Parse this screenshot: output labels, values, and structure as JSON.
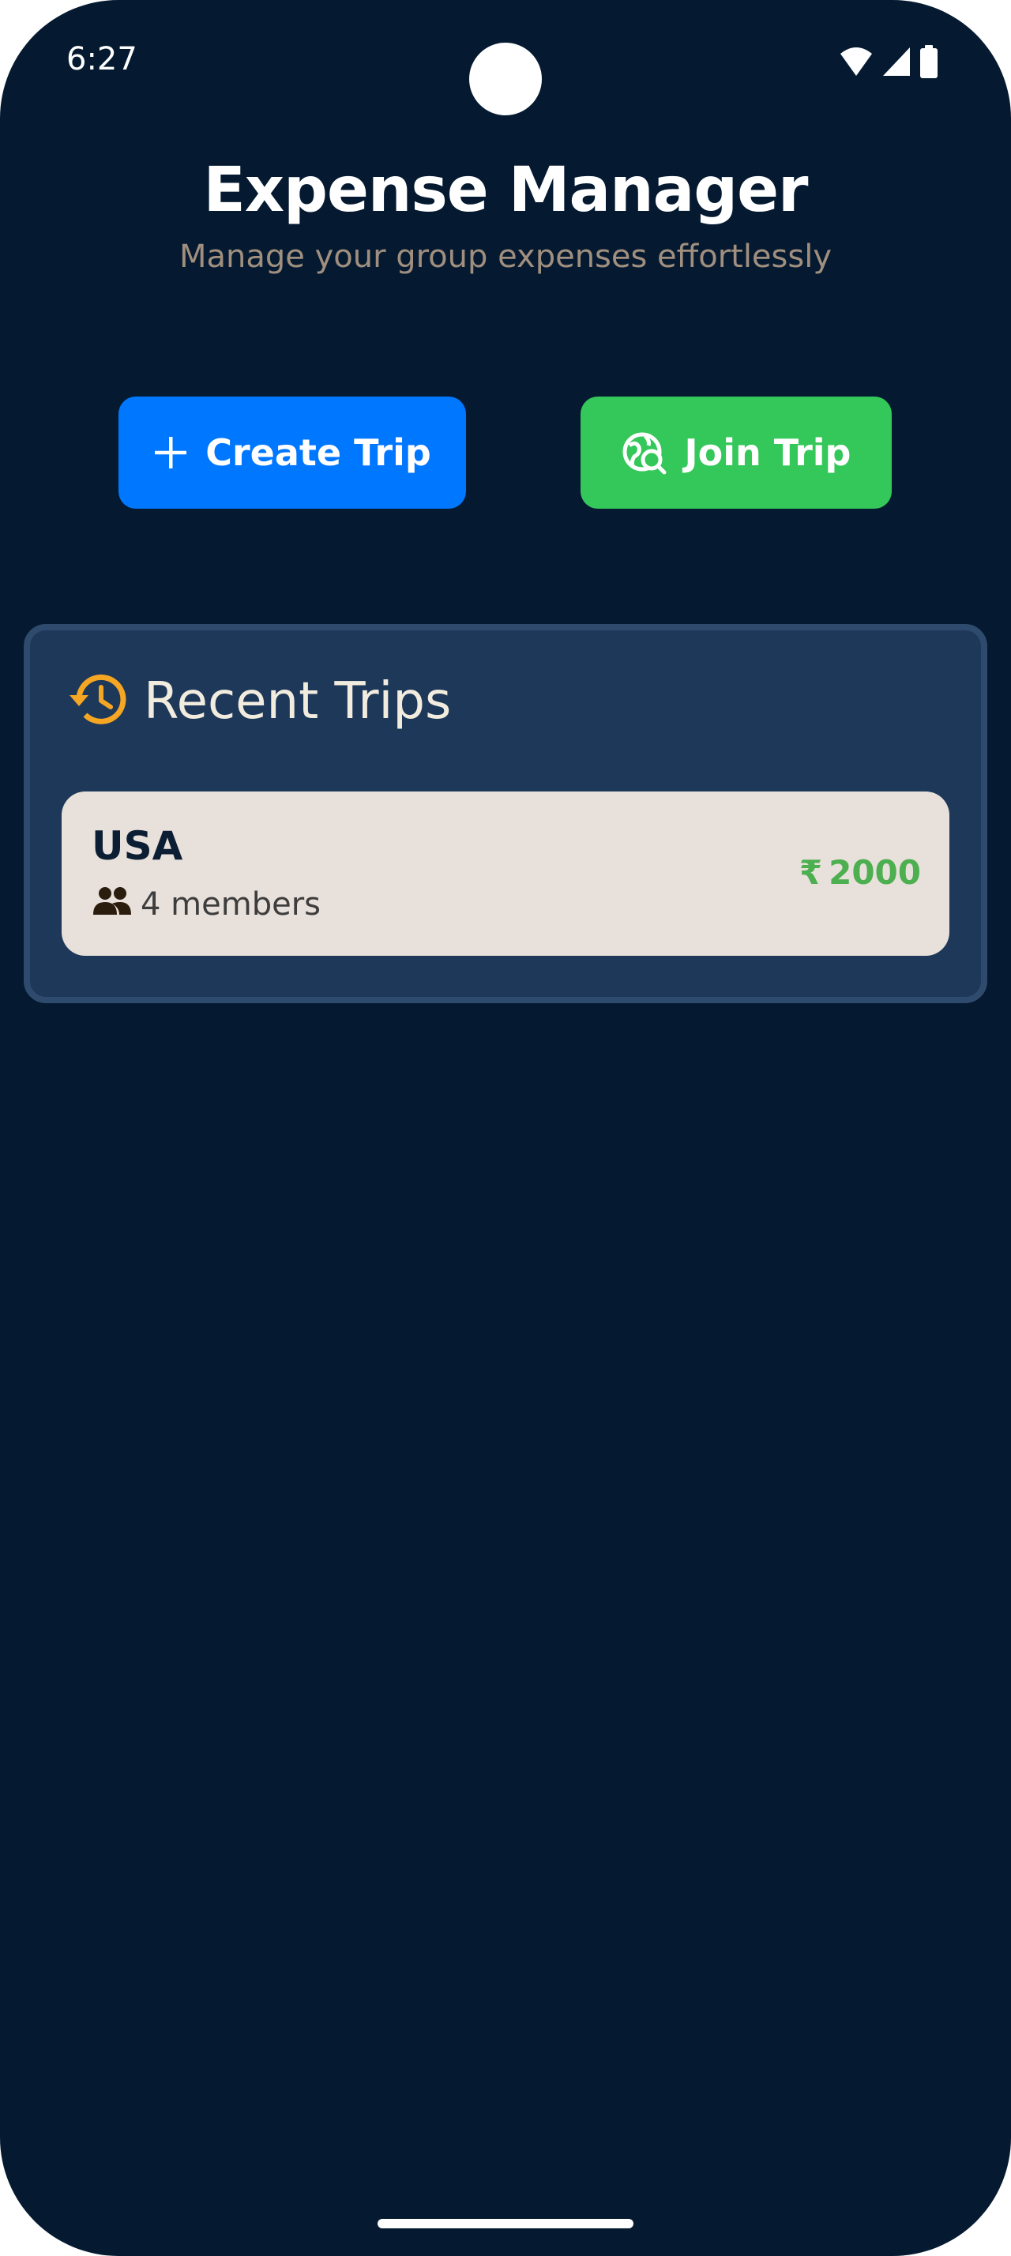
{
  "status_bar": {
    "time": "6:27",
    "icons": [
      "wifi-icon",
      "signal-icon",
      "battery-icon"
    ]
  },
  "header": {
    "title": "Expense Manager",
    "subtitle": "Manage your group expenses effortlessly"
  },
  "actions": {
    "create_label": "Create Trip",
    "create_icon": "plus-icon",
    "join_label": "Join Trip",
    "join_icon": "globe-search-icon"
  },
  "recent": {
    "title": "Recent Trips",
    "icon": "history-icon",
    "trips": [
      {
        "name": "USA",
        "members": "4 members",
        "currency": "₹",
        "amount": "2000"
      }
    ]
  },
  "colors": {
    "background": "#051a31",
    "create_button": "#0077ff",
    "join_button": "#34c759",
    "panel": "#1e385a",
    "accent": "#f5a623",
    "amount": "#4caf50",
    "card": "#e8e0da"
  }
}
